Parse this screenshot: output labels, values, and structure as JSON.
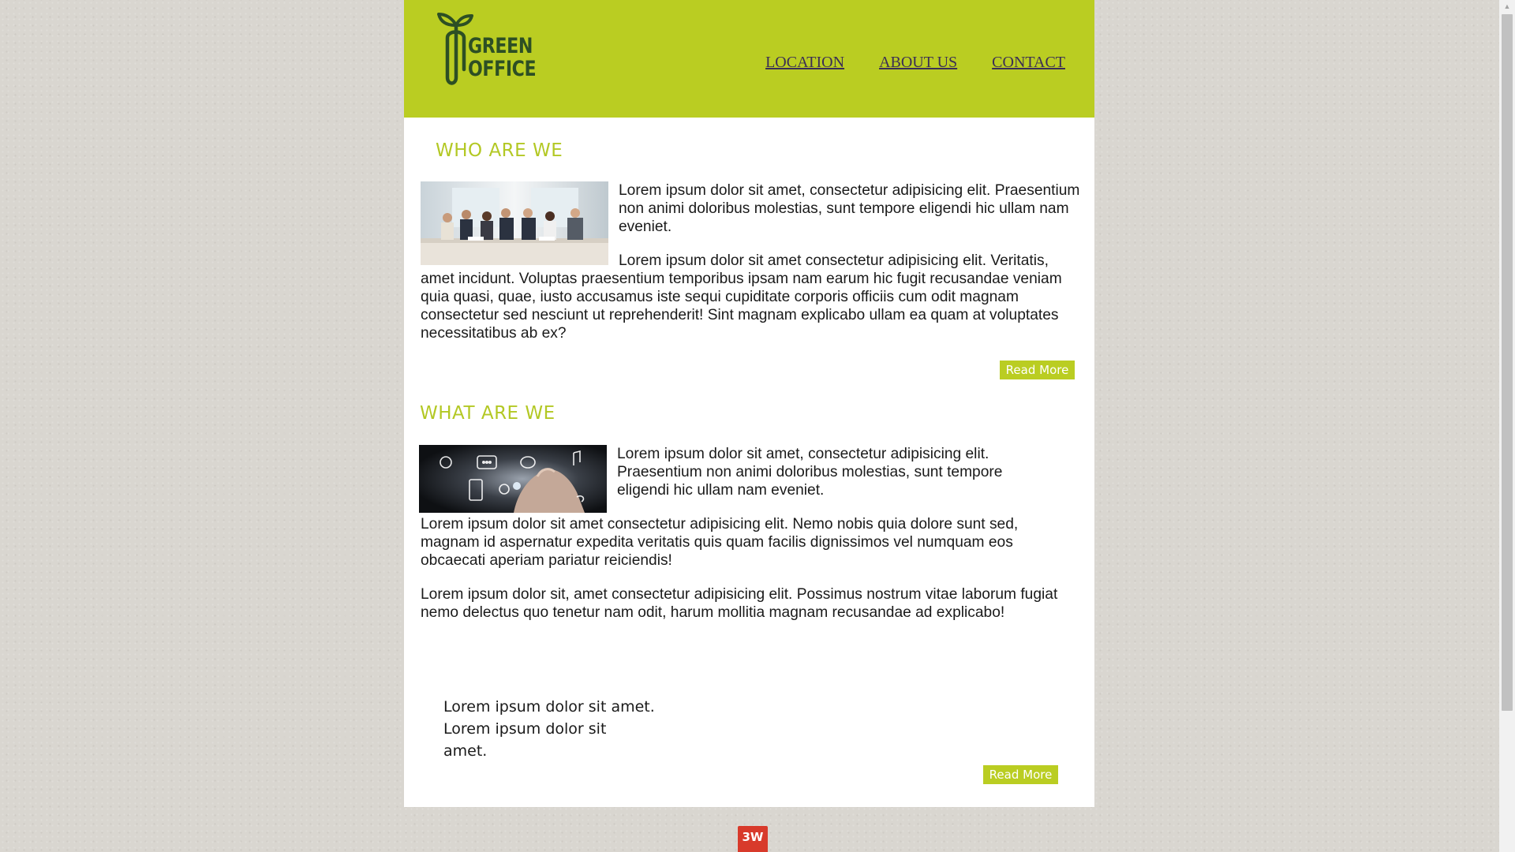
{
  "logo": {
    "line1": "GREEN",
    "line2": "OFFICE"
  },
  "nav": {
    "items": [
      "LOCATION",
      "ABOUT US",
      "CONTACT"
    ]
  },
  "section1": {
    "title": "WHO ARE WE",
    "image": "business-team-photo",
    "para1": "Lorem ipsum dolor sit amet, consectetur adipisicing elit. Praesentium non animi doloribus molestias, sunt tempore eligendi hic ullam nam eveniet.",
    "para2": "Lorem ipsum dolor sit amet consectetur adipisicing elit. Veritatis, amet incidunt. Voluptas praesentium temporibus ipsam nam earum hic fugit recusandae veniam quia quasi, quae, iusto accusamus iste sequi cupiditate corporis officiis cum odit magnam consectetur sed nesciunt ut reprehenderit! Sint magnam explicabo ullam ea quam at voluptates necessitatibus ab ex?",
    "read_more": "Read More"
  },
  "section2": {
    "title": "WHAT ARE WE",
    "image": "touch-tech-photo",
    "para1": "Lorem ipsum dolor sit amet, consectetur adipisicing elit. Praesentium non animi doloribus molestias, sunt tempore eligendi hic ullam nam eveniet.",
    "para2": "Lorem ipsum dolor sit amet consectetur adipisicing elit. Nemo nobis quia dolore sunt sed, magnam id aspernatur expedita veritatis quis quam facilis dignissimos vel numquam eos obcaecati aperiam pariatur reiciendis!",
    "para3": "Lorem ipsum dolor sit, amet consectetur adipisicing elit. Possimus nostrum vitae laborum fugiat nemo delectus quo tenetur nam odit, harum mollitia magnam recusandae ad explicabo!"
  },
  "quote": {
    "line1": "Lorem ipsum dolor sit amet.",
    "line2": "Lorem ipsum dolor sit",
    "line3": "amet.",
    "read_more": "Read More"
  },
  "footer": {
    "badge": "3W"
  },
  "colors": {
    "brand_green": "#bacd22",
    "title_green": "#b3c824",
    "badge_red": "#d83a2b"
  }
}
